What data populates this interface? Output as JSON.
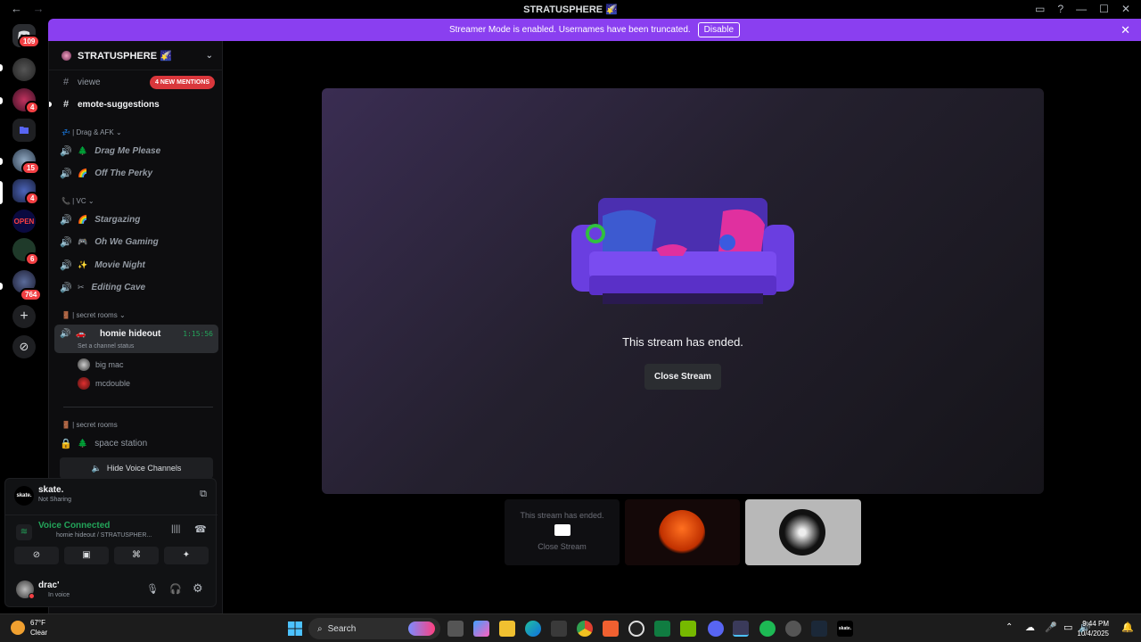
{
  "window": {
    "title": "STRATUSPHERE 🌠",
    "back": "←",
    "forward": "→"
  },
  "rail": {
    "dm_badge": "109",
    "badges": [
      "4",
      "15",
      "4",
      "6",
      "764"
    ],
    "open_label": "OPEN"
  },
  "banner": {
    "message": "Streamer Mode is enabled. Usernames have been truncated.",
    "disable_label": "Disable"
  },
  "guild": {
    "name": "STRATUSPHERE 🌠"
  },
  "channels": {
    "mentions_label": "4 NEW MENTIONS",
    "text1": "viewe",
    "text2": "emote-suggestions",
    "cat1": "💤 | Drag & AFK ⌄",
    "v1": "Drag Me Please",
    "v2": "Off The Perky",
    "cat2": "📞 | VC ⌄",
    "v3": "Stargazing",
    "v4": "Oh We Gaming",
    "v5": "Movie Night",
    "v6": "Editing Cave",
    "cat3": "🚪 | secret rooms ⌄",
    "active_name": "homie hideout",
    "active_timer": "1:15:56",
    "active_status": "Set a channel status",
    "user1": "big mac",
    "user2": "mcdouble",
    "cat4": "🚪 | secret rooms",
    "v7": "space station",
    "hide_label": "Hide Voice Channels"
  },
  "panel": {
    "stream_user": "skate.",
    "stream_status": "Not Sharing",
    "avatar_text": "skate.",
    "voice_status": "Voice Connected",
    "voice_channel": "homie hideout / STRATUSPHER...",
    "user_name": "drac'",
    "user_status": "In voice"
  },
  "stream": {
    "ended_text": "This stream has ended.",
    "close_label": "Close Stream"
  },
  "thumbs": {
    "ended_text": "This stream has ended.",
    "close_label": "Close Stream"
  },
  "taskbar": {
    "temp": "67°F",
    "condition": "Clear",
    "search_placeholder": "Search",
    "time": "9:44 PM",
    "date": "10/4/2025",
    "skate_label": "skate."
  },
  "colors": {
    "accent": "#8a3ff0",
    "online": "#23a55a",
    "badge": "#f23f43"
  }
}
